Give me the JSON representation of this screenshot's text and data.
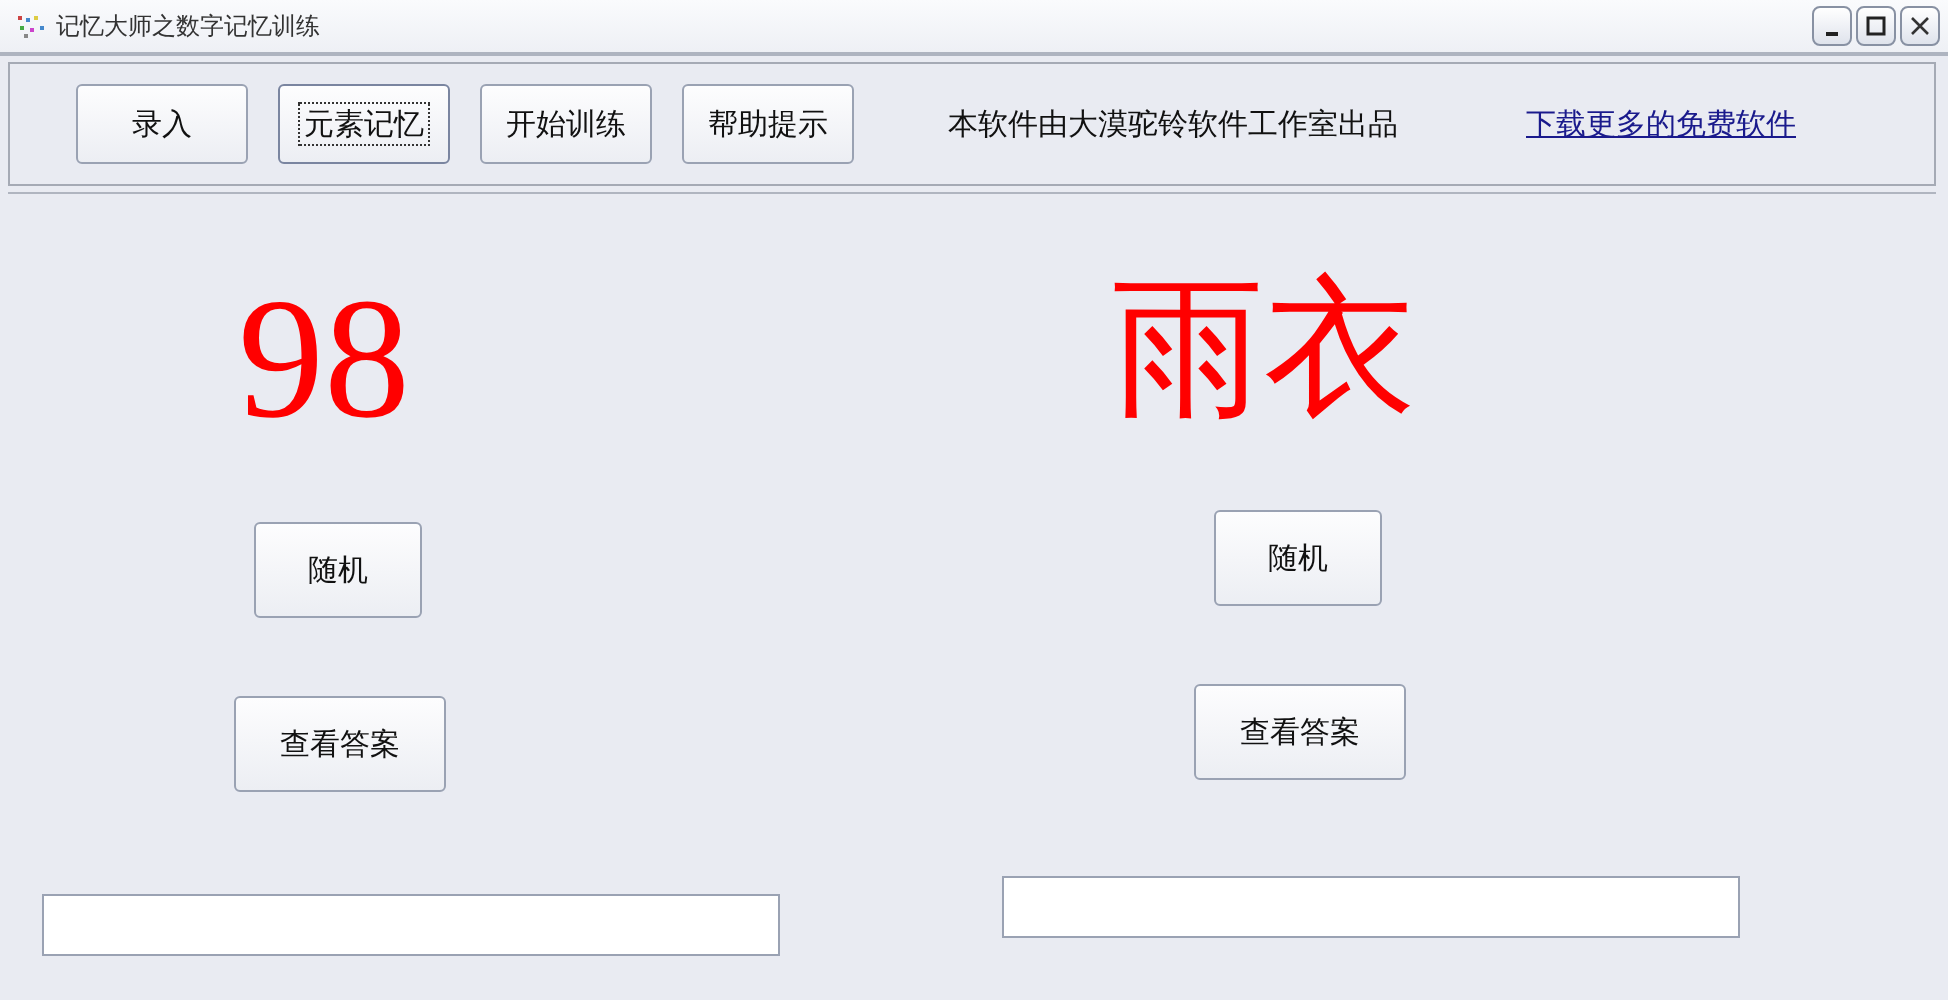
{
  "window": {
    "title": "记忆大师之数字记忆训练"
  },
  "toolbar": {
    "buttons": [
      {
        "label": "录入",
        "focused": false
      },
      {
        "label": "元素记忆",
        "focused": true
      },
      {
        "label": "开始训练",
        "focused": false
      },
      {
        "label": "帮助提示",
        "focused": false
      }
    ],
    "credit": "本软件由大漠驼铃软件工作室出品",
    "link": "下载更多的免费软件"
  },
  "panels": [
    {
      "display": "98",
      "random_button": "随机",
      "answer_button": "查看答案"
    },
    {
      "display": "雨衣",
      "random_button": "随机",
      "answer_button": "查看答案"
    }
  ]
}
